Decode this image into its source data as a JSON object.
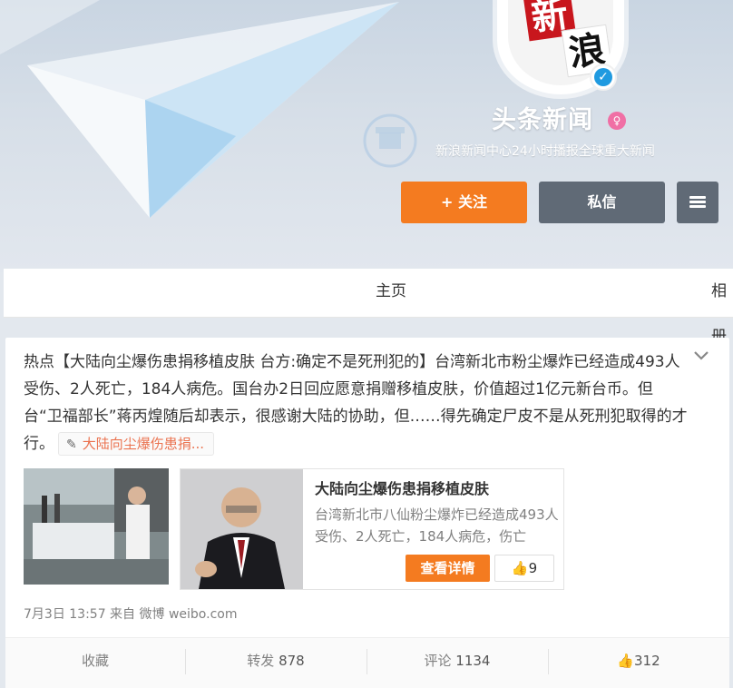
{
  "profile": {
    "avatar_logo_top": "新",
    "avatar_logo_bottom": "浪",
    "name": "头条新闻",
    "description": "新浪新闻中心24小时播报全球重大新闻"
  },
  "header_buttons": {
    "follow_label": "关注",
    "message_label": "私信"
  },
  "tabs": [
    {
      "label": "主页"
    },
    {
      "label": "相册"
    }
  ],
  "post": {
    "text_tag": "热点",
    "text_body": "【大陆向尘爆伤患捐移植皮肤 台方:确定不是死刑犯的】台湾新北市粉尘爆炸已经造成493人受伤、2人死亡，184人病危。国台办2日回应愿意捐赠移植皮肤，价值超过1亿元新台币。但台“卫福部长”蒋丙煌随后却表示，很感谢大陆的协助，但……得先确定尸皮不是从死刑犯取得的才行。",
    "link_label": "大陆向尘爆伤患捐...",
    "share_card": {
      "title": "大陆向尘爆伤患捐移植皮肤",
      "description": "台湾新北市八仙粉尘爆炸已经造成493人受伤、2人死亡，184人病危，伤亡",
      "details_label": "查看详情",
      "like_count": "9"
    },
    "meta": "7月3日 13:57 来自 微博 weibo.com",
    "actions": {
      "favorite_label": "收藏",
      "forward_label": "转发",
      "forward_count": "878",
      "comment_label": "评论",
      "comment_count": "1134",
      "like_count": "312"
    }
  },
  "colors": {
    "accent": "#f47b20",
    "secondary_button": "#606a76",
    "link": "#eb7350",
    "verified": "#1f9ae0"
  }
}
